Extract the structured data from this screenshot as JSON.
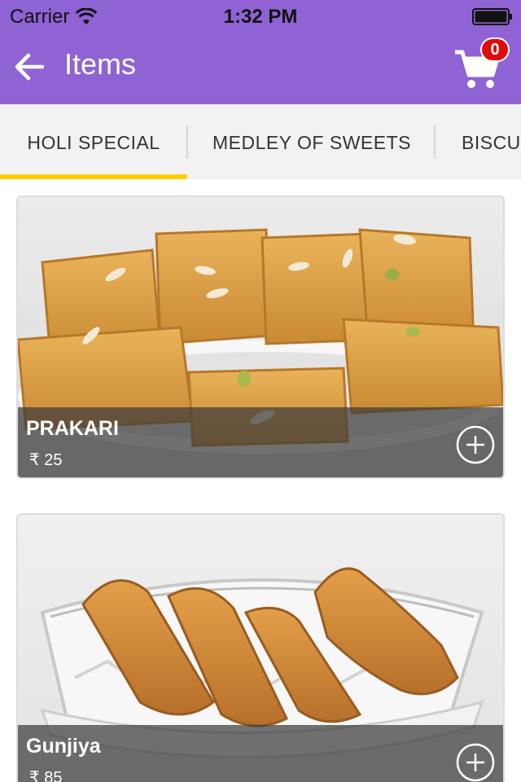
{
  "status_bar": {
    "carrier": "Carrier",
    "time": "1:32 PM"
  },
  "nav": {
    "title": "Items",
    "cart_count": "0",
    "back_icon": "arrow-left-icon",
    "cart_icon": "shopping-cart-icon"
  },
  "tabs": [
    {
      "label": "HOLI SPECIAL",
      "selected": true
    },
    {
      "label": "MEDLEY OF SWEETS",
      "selected": false
    },
    {
      "label": "BISCU",
      "selected": false
    }
  ],
  "items": [
    {
      "name": "PRAKARI",
      "price": "₹ 25",
      "add_icon": "plus-circle-icon"
    },
    {
      "name": "Gunjiya",
      "price": "₹ 85",
      "add_icon": "plus-circle-icon"
    }
  ],
  "colors": {
    "header": "#8f63d3",
    "tab_indicator": "#ffd000",
    "badge": "#e00b0b",
    "tab_bar": "#f2f2f2"
  }
}
